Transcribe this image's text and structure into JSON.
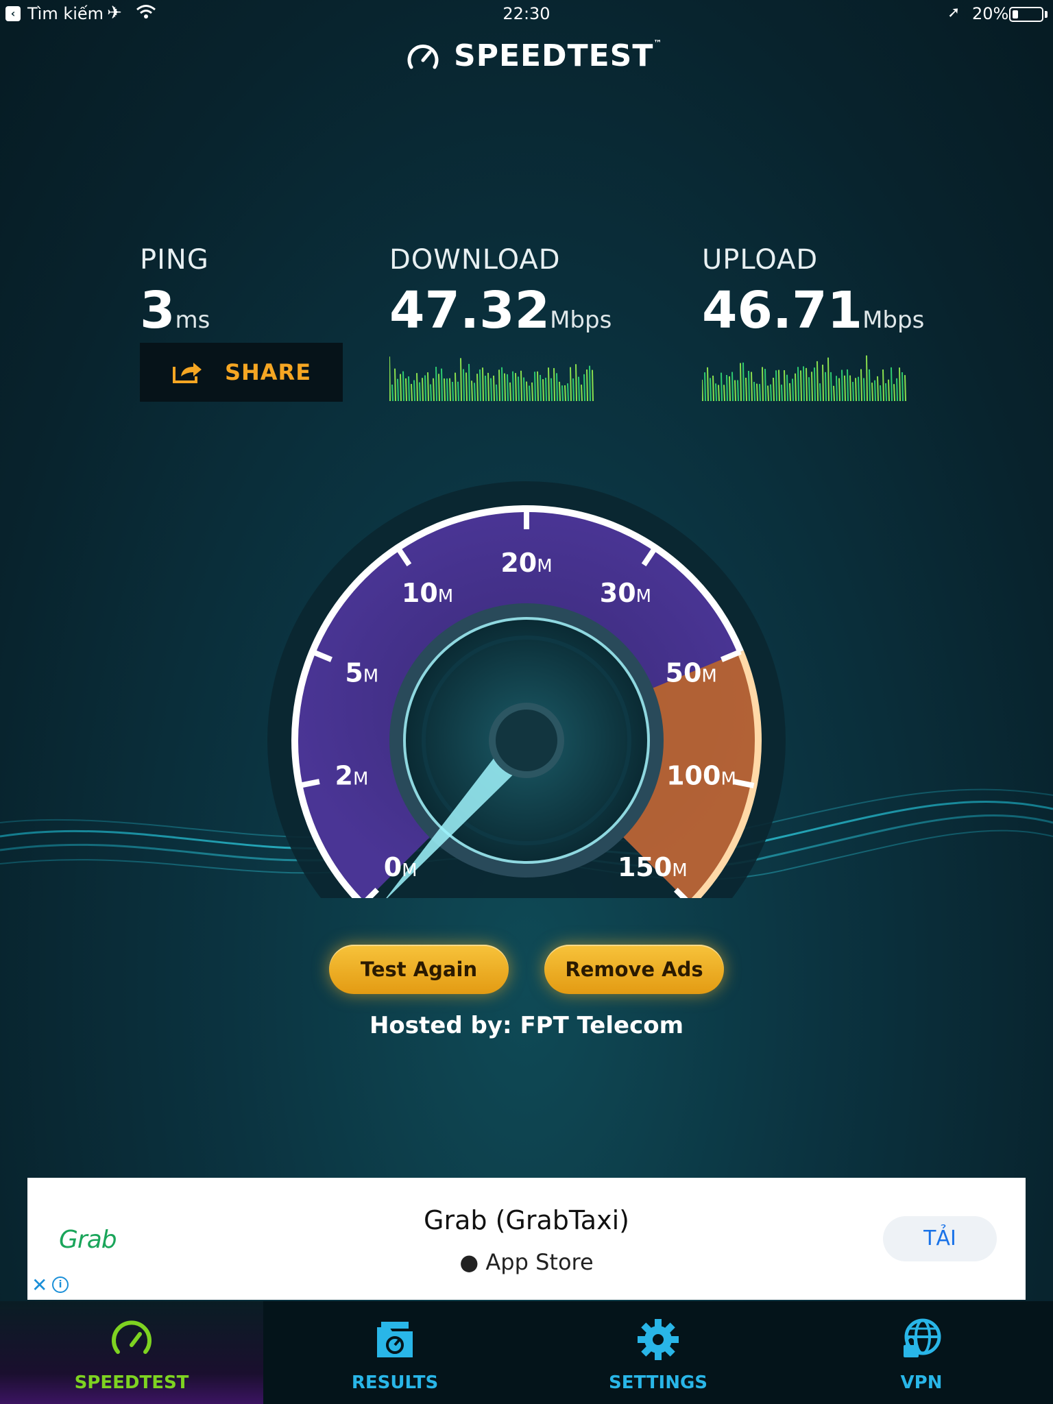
{
  "status_bar": {
    "back_label": "Tìm kiếm",
    "time": "22:30",
    "battery_percent": "20%",
    "battery_level": 0.2
  },
  "header": {
    "title": "SPEEDTEST",
    "trademark": "™"
  },
  "results": {
    "ping": {
      "label": "PING",
      "value": "3",
      "unit": "ms"
    },
    "download": {
      "label": "DOWNLOAD",
      "value": "47.32",
      "unit": "Mbps"
    },
    "upload": {
      "label": "UPLOAD",
      "value": "46.71",
      "unit": "Mbps"
    },
    "share_label": "SHARE"
  },
  "gauge": {
    "ticks": [
      {
        "num": "0",
        "unit": "M"
      },
      {
        "num": "2",
        "unit": "M"
      },
      {
        "num": "5",
        "unit": "M"
      },
      {
        "num": "10",
        "unit": "M"
      },
      {
        "num": "20",
        "unit": "M"
      },
      {
        "num": "30",
        "unit": "M"
      },
      {
        "num": "50",
        "unit": "M"
      },
      {
        "num": "100",
        "unit": "M"
      },
      {
        "num": "150",
        "unit": "M"
      }
    ],
    "needle_value": 0
  },
  "actions": {
    "test_again": "Test Again",
    "remove_ads": "Remove Ads",
    "hosted_by": "Hosted by: FPT Telecom"
  },
  "ad": {
    "brand": "Grab",
    "title": "Grab (GrabTaxi)",
    "store": "App Store",
    "cta": "TẢI"
  },
  "tabs": [
    {
      "label": "SPEEDTEST",
      "icon": "speedometer-icon",
      "active": true
    },
    {
      "label": "RESULTS",
      "icon": "results-folder-icon",
      "active": false
    },
    {
      "label": "SETTINGS",
      "icon": "gear-icon",
      "active": false
    },
    {
      "label": "VPN",
      "icon": "globe-lock-icon",
      "active": false
    }
  ],
  "colors": {
    "accent_orange": "#f5a623",
    "tab_active_green": "#7ed321",
    "tab_inactive_blue": "#29b6e8",
    "gauge_purple": "#5b3d9e",
    "gauge_orange": "#d9782a"
  }
}
